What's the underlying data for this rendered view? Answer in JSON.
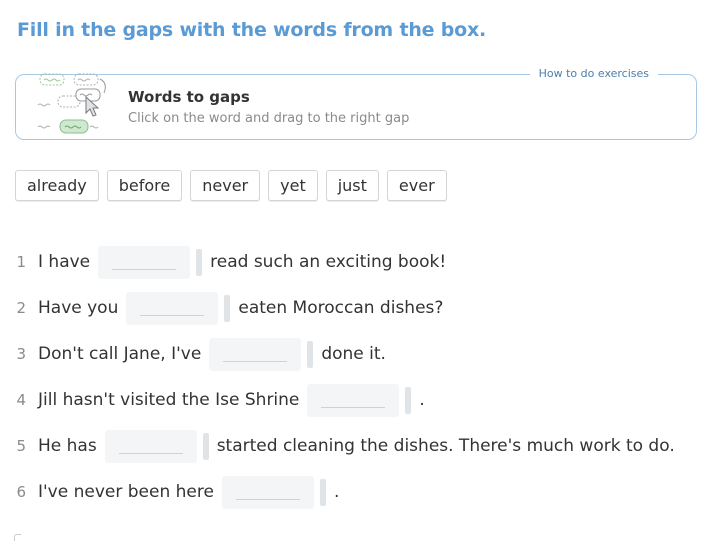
{
  "exercise": {
    "title": "Fill in the gaps with the words from the box."
  },
  "howto": {
    "link_label": "How to do exercises",
    "heading": "Words to gaps",
    "subtext": "Click on the word and drag to the right gap",
    "illustration_icon": "drag-word-illustration-icon"
  },
  "word_bank": [
    "already",
    "before",
    "never",
    "yet",
    "just",
    "ever"
  ],
  "sentences": [
    {
      "number": "1",
      "before": "I have",
      "after": "read such an exciting book!"
    },
    {
      "number": "2",
      "before": "Have you",
      "after": "eaten Moroccan dishes?"
    },
    {
      "number": "3",
      "before": "Don't call Jane, I've",
      "after": "done it."
    },
    {
      "number": "4",
      "before": "Jill hasn't visited the Ise Shrine",
      "after": "."
    },
    {
      "number": "5",
      "before": "He has",
      "after": "started cleaning the dishes. There's much work to do."
    },
    {
      "number": "6",
      "before": "I've never been here",
      "after": "."
    }
  ],
  "colors": {
    "title": "#5b9bd5",
    "box_border": "#a9c8e3",
    "gap_fill": "#f3f5f7"
  }
}
